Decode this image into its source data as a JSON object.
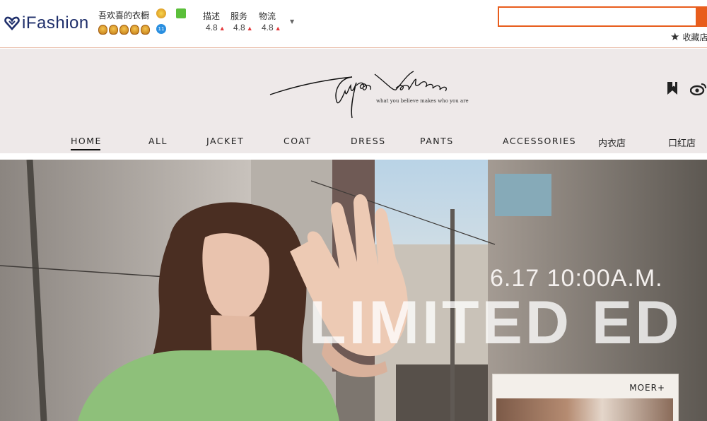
{
  "topbar": {
    "logo_text": "iFashion",
    "shop_name": "吾欢喜的衣橱",
    "ratings": [
      {
        "label": "描述",
        "value": "4.8"
      },
      {
        "label": "服务",
        "value": "4.8"
      },
      {
        "label": "物流",
        "value": "4.8"
      }
    ],
    "blue_badge": "11",
    "search_placeholder": "",
    "favorite_label": "收藏店"
  },
  "header": {
    "brand_signature": "Sugu Vendue",
    "brand_tagline": "what you believe makes who you are",
    "nav": [
      {
        "label": "HOME",
        "active": true
      },
      {
        "label": "ALL"
      },
      {
        "label": "JACKET"
      },
      {
        "label": "COAT"
      },
      {
        "label": "DRESS"
      },
      {
        "label": "PANTS"
      },
      {
        "label": "ACCESSORIES"
      },
      {
        "label": "内衣店"
      },
      {
        "label": "口红店"
      }
    ]
  },
  "banner": {
    "date_text": "6.17 10:00A.M.",
    "headline": "LIMITED ED",
    "card_label": "MOER+"
  },
  "colors": {
    "accent": "#e85d1c",
    "header_bg": "#eee9e9",
    "logo_blue": "#1f2f6b",
    "rating_up": "#e4393c"
  }
}
